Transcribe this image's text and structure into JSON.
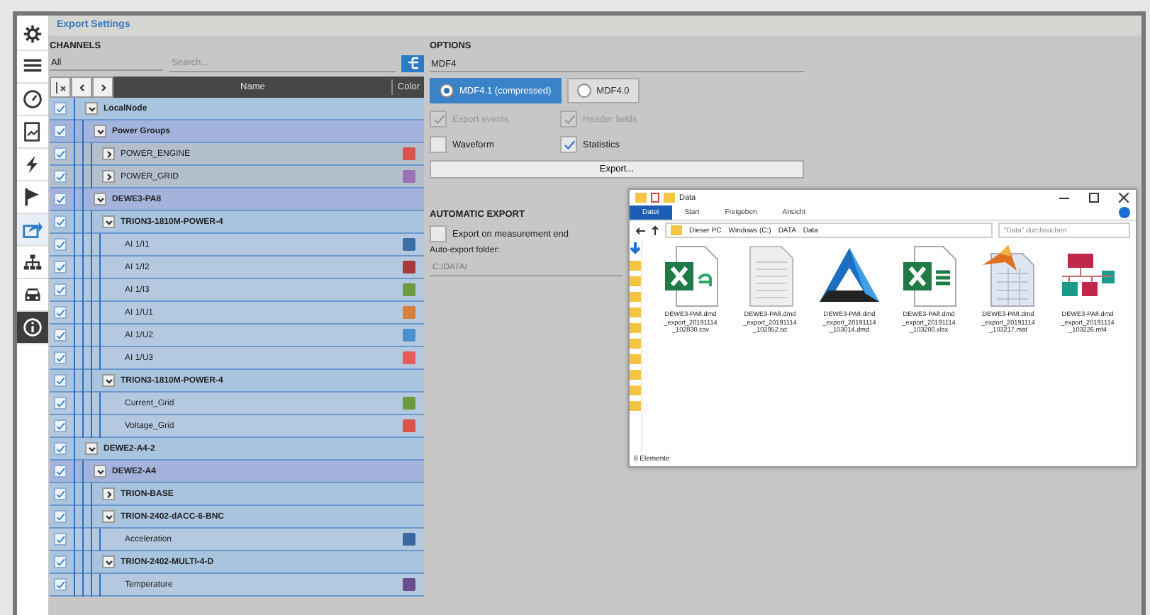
{
  "window": {
    "title": "Export Settings"
  },
  "sidebar": {
    "items": [
      {
        "selected": false
      },
      {
        "selected": false
      },
      {
        "selected": false
      },
      {
        "selected": false
      },
      {
        "selected": false
      },
      {
        "selected": false
      },
      {
        "selected": true
      },
      {
        "selected": false
      },
      {
        "selected": false
      },
      {
        "selected": false
      }
    ]
  },
  "channels": {
    "heading": "CHANNELS",
    "filter": "All",
    "search": {
      "placeholder": "Search..."
    },
    "columns": [
      "Name",
      "Color"
    ],
    "tree": [
      {
        "name": "LocalNode",
        "kind": "device",
        "checked": true,
        "expanded": true,
        "children": [
          {
            "name": "Power Groups",
            "kind": "device",
            "checked": true,
            "expanded": true,
            "children": [
              {
                "name": "POWER_ENGINE",
                "kind": "group",
                "checked": true,
                "expanded": false,
                "color": "#d9534a"
              },
              {
                "name": "POWER_GRID",
                "kind": "group",
                "checked": true,
                "expanded": false,
                "color": "#9b72b8"
              }
            ]
          },
          {
            "name": "DEWE3-PA8",
            "kind": "device",
            "checked": true,
            "expanded": true,
            "children": [
              {
                "name": "TRION3-1810M-POWER-4",
                "kind": "device",
                "checked": true,
                "expanded": true,
                "children": [
                  {
                    "name": "AI 1/I1",
                    "kind": "channel",
                    "checked": true,
                    "color": "#3a6ea5"
                  },
                  {
                    "name": "AI 1/I2",
                    "kind": "channel",
                    "checked": true,
                    "color": "#a83a3a"
                  },
                  {
                    "name": "AI 1/I3",
                    "kind": "channel",
                    "checked": true,
                    "color": "#6c9a3c"
                  },
                  {
                    "name": "AI 1/U1",
                    "kind": "channel",
                    "checked": true,
                    "color": "#d9803a"
                  },
                  {
                    "name": "AI 1/U2",
                    "kind": "channel",
                    "checked": true,
                    "color": "#4a90d0"
                  },
                  {
                    "name": "AI 1/U3",
                    "kind": "channel",
                    "checked": true,
                    "color": "#e85a5a"
                  }
                ]
              },
              {
                "name": "TRION3-1810M-POWER-4",
                "kind": "device",
                "checked": true,
                "expanded": true,
                "children": [
                  {
                    "name": "Current_Grid",
                    "kind": "channel",
                    "checked": true,
                    "color": "#6c9a3c"
                  },
                  {
                    "name": "Voltage_Grid",
                    "kind": "channel",
                    "checked": true,
                    "color": "#d9534a"
                  }
                ]
              }
            ]
          }
        ]
      },
      {
        "name": "DEWE2-A4-2",
        "kind": "device",
        "checked": true,
        "expanded": true,
        "children": [
          {
            "name": "DEWE2-A4",
            "kind": "device",
            "checked": true,
            "expanded": true,
            "children": [
              {
                "name": "TRION-BASE",
                "kind": "device",
                "checked": true,
                "expanded": false
              },
              {
                "name": "TRION-2402-dACC-6-BNC",
                "kind": "device",
                "checked": true,
                "expanded": true,
                "children": [
                  {
                    "name": "Acceleration",
                    "kind": "channel",
                    "checked": true,
                    "color": "#3a6aa0"
                  }
                ]
              },
              {
                "name": "TRION-2402-MULTI-4-D",
                "kind": "device",
                "checked": true,
                "expanded": true,
                "children": [
                  {
                    "name": "Temperature",
                    "kind": "channel",
                    "checked": true,
                    "color": "#6a4e90"
                  }
                ]
              }
            ]
          }
        ]
      }
    ]
  },
  "options": {
    "heading": "OPTIONS",
    "format": "MDF4",
    "variants": [
      {
        "label": "MDF4.1 (compressed)",
        "selected": true
      },
      {
        "label": "MDF4.0",
        "selected": false
      }
    ],
    "checks": [
      [
        {
          "label": "Export events",
          "checked": true,
          "disabled": true
        },
        {
          "label": "Header fields",
          "checked": true,
          "disabled": true
        }
      ],
      [
        {
          "label": "Waveform",
          "checked": false,
          "disabled": false
        },
        {
          "label": "Statistics",
          "checked": true,
          "disabled": false
        }
      ]
    ],
    "export_button": "Export..."
  },
  "automatic_export": {
    "heading": "AUTOMATIC EXPORT",
    "on_end": {
      "label": "Export on measurement end",
      "checked": false
    },
    "folder_label": "Auto-export folder:",
    "folder": "C:/DATA/"
  },
  "explorer": {
    "title": "Data",
    "tabs": [
      {
        "label": "Datei",
        "selected": true
      },
      {
        "label": "Start",
        "selected": false
      },
      {
        "label": "Freigeben",
        "selected": false
      },
      {
        "label": "Ansicht",
        "selected": false
      }
    ],
    "path": [
      "Dieser PC",
      "Windows (C:)",
      "DATA",
      "Data"
    ],
    "search": {
      "placeholder": "\"Data\" durchsuchen"
    },
    "files": [
      {
        "kind": "csv",
        "name": "DEWE3-PA8.dmd\n_export_20191114\n_102830.csv"
      },
      {
        "kind": "txt",
        "name": "DEWE3-PA8.dmd\n_export_20191114\n_102952.txt"
      },
      {
        "kind": "dmd",
        "name": "DEWE3-PA8.dmd\n_export_20191114\n_103014.dmd"
      },
      {
        "kind": "xlsx",
        "name": "DEWE3-PA8.dmd\n_export_20191114\n_103200.xlsx"
      },
      {
        "kind": "mat",
        "name": "DEWE3-PA8.dmd\n_export_20191114\n_103217.mat"
      },
      {
        "kind": "mf4",
        "name": "DEWE3-PA8.dmd\n_export_20191114\n_103226.mf4"
      }
    ],
    "status": "6 Elemente"
  }
}
